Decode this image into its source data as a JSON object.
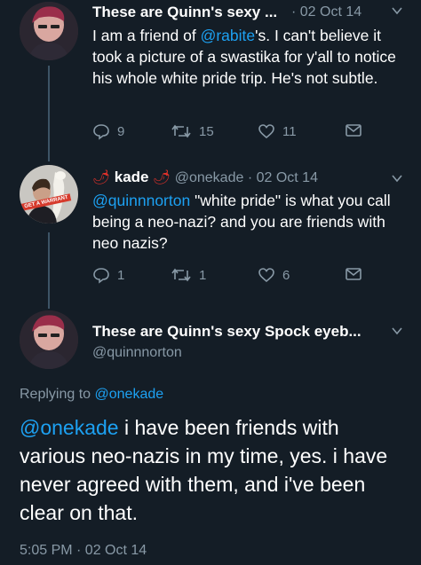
{
  "tweet1": {
    "name": "These are Quinn's sexy ...",
    "time": "· 02 Oct 14",
    "text_before": "I am a friend of ",
    "mention": "@rabite",
    "text_after": "'s. I can't believe it took a picture of a swastika for y'all to notice his whole white pride trip. He's not subtle.",
    "replies": "9",
    "retweets": "15",
    "likes": "11"
  },
  "tweet2": {
    "emoji_left": "🌶",
    "name": "kade",
    "emoji_right": "🌶",
    "handle_time": "@onekade · 02 Oct 14",
    "mention": "@quinnnorton",
    "text": " \"white pride\" is what you call being a neo-nazi? and you are friends with neo nazis?",
    "avatar_badge": "GET A WARRANT",
    "replies": "1",
    "retweets": "1",
    "likes": "6"
  },
  "main_tweet": {
    "name": "These are Quinn's sexy Spock eyeb...",
    "handle": "@quinnnorton",
    "replying_prefix": "Replying to ",
    "replying_handle": "@onekade",
    "mention": "@onekade",
    "text": " i have been friends with various neo-nazis in my time, yes. i have never agreed with them, and i've been clear on that.",
    "timestamp": "5:05 PM · 02 Oct 14"
  },
  "colors": {
    "background": "#141d26",
    "accent": "#1da1f2",
    "muted": "#8899a6"
  },
  "icons": [
    "reply-icon",
    "retweet-icon",
    "like-icon",
    "message-icon",
    "chevron-down-icon"
  ]
}
